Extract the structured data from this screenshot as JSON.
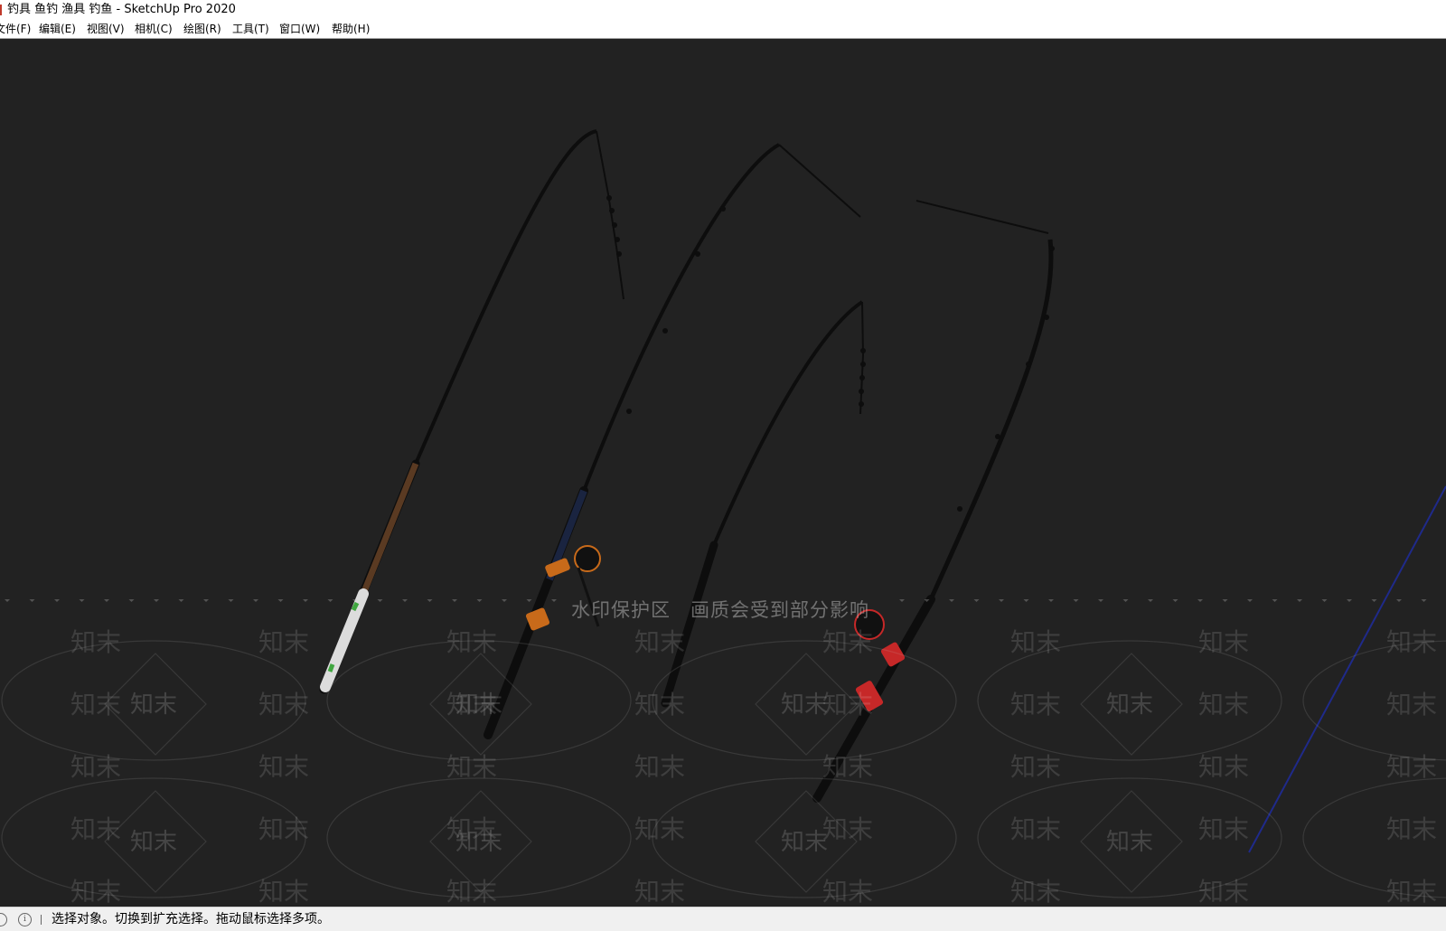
{
  "window": {
    "title": "钓具 鱼钓 渔具 钓鱼 - SketchUp Pro 2020"
  },
  "menu": [
    {
      "key": "file",
      "label": "文件(F)"
    },
    {
      "key": "edit",
      "label": "编辑(E)"
    },
    {
      "key": "view",
      "label": "视图(V)"
    },
    {
      "key": "camera",
      "label": "相机(C)"
    },
    {
      "key": "draw",
      "label": "绘图(R)"
    },
    {
      "key": "tools",
      "label": "工具(T)"
    },
    {
      "key": "window",
      "label": "窗口(W)"
    },
    {
      "key": "help",
      "label": "帮助(H)"
    }
  ],
  "watermark": {
    "notice": "水印保护区　画质会受到部分影响",
    "word": "知末"
  },
  "status": {
    "hint": "选择对象。切换到扩充选择。拖动鼠标选择多项。"
  },
  "colors": {
    "viewport_bg": "#222222",
    "rod": "#0d0d0d",
    "grip_green": "#3fa63f",
    "grip_orange": "#c86a1a",
    "grip_red": "#c62828",
    "axis_blue": "#1f2a8a"
  },
  "icons": {
    "app": "sketchup-app-icon",
    "status_1": "geo-location-icon",
    "status_2": "info-icon"
  }
}
